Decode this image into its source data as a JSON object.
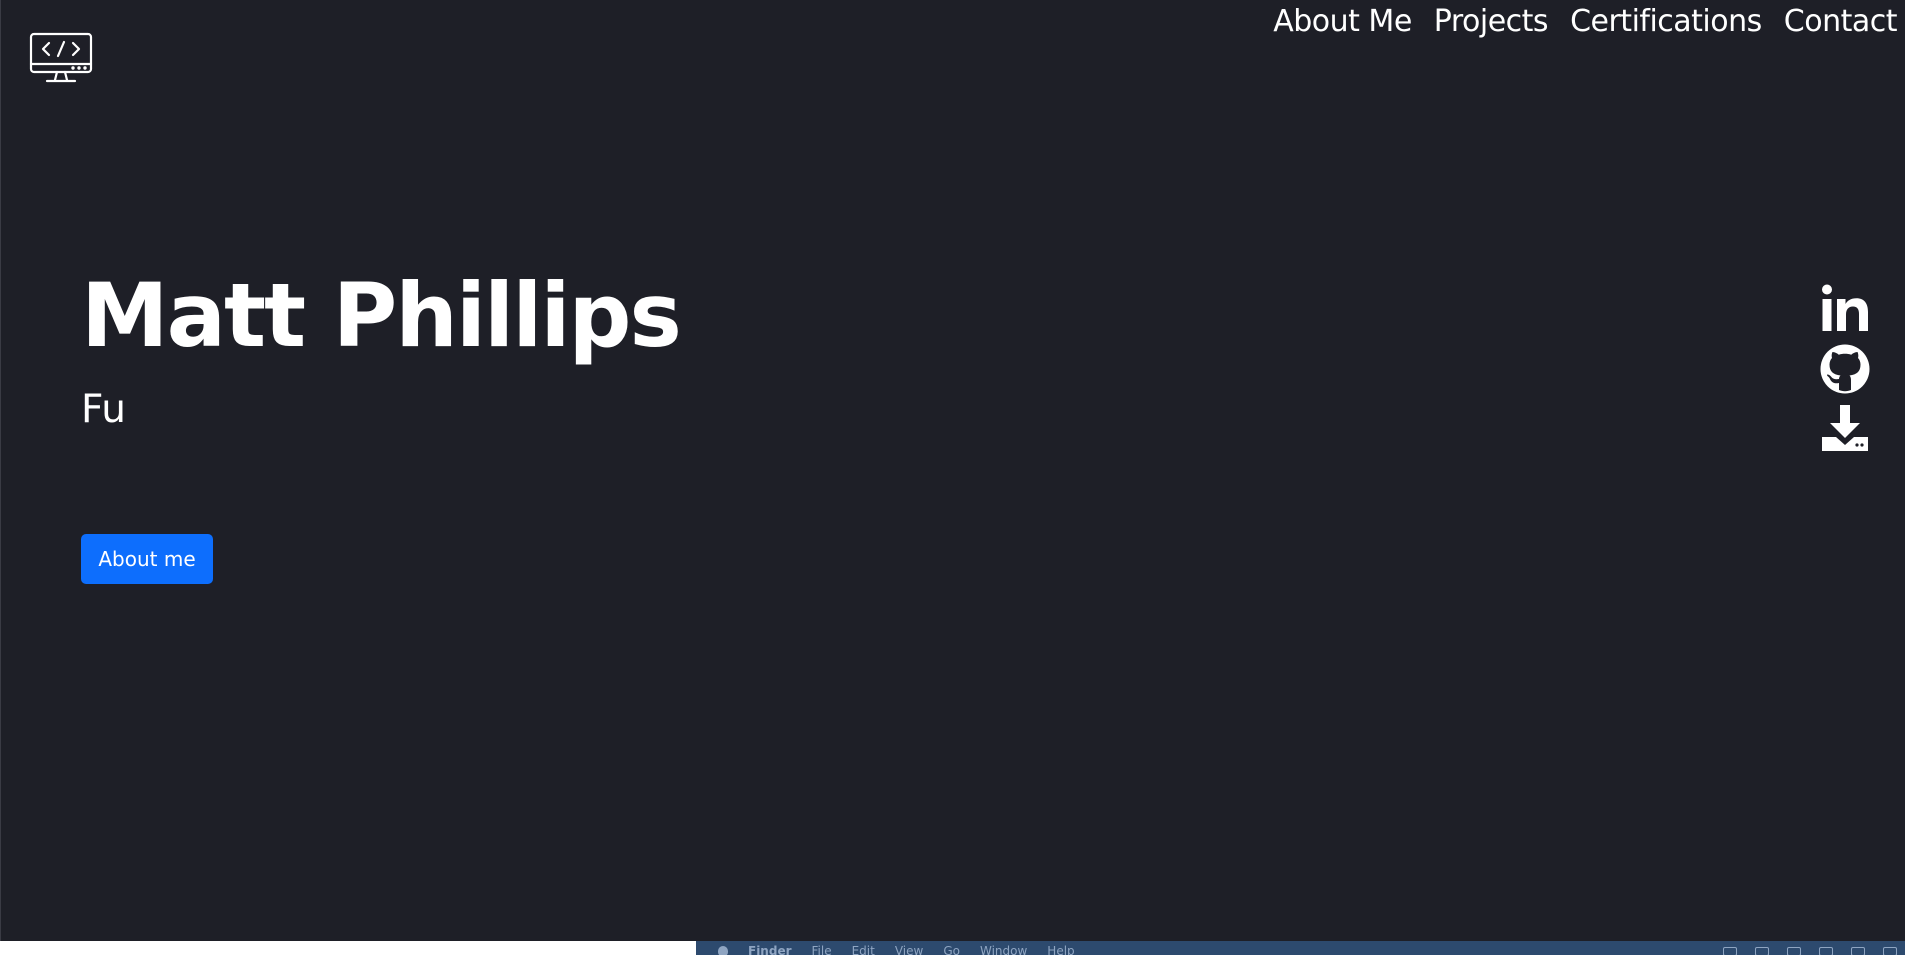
{
  "nav": {
    "items": [
      {
        "label": "About Me",
        "name": "nav-about-me"
      },
      {
        "label": "Projects",
        "name": "nav-projects"
      },
      {
        "label": "Certifications",
        "name": "nav-certifications"
      },
      {
        "label": "Contact",
        "name": "nav-contact"
      }
    ]
  },
  "hero": {
    "name": "Matt Phillips",
    "subtitle": "Fu",
    "cta_label": "About me"
  },
  "socials": {
    "icons": [
      "linkedin-icon",
      "github-icon",
      "download-icon"
    ]
  },
  "logo": {
    "icon": "monitor-code-icon"
  },
  "menubar": {
    "app": "Finder",
    "items": [
      "File",
      "Edit",
      "View",
      "Go",
      "Window",
      "Help"
    ]
  },
  "colors": {
    "background": "#1e1f27",
    "accent": "#0d6efd",
    "text": "#ffffff"
  }
}
